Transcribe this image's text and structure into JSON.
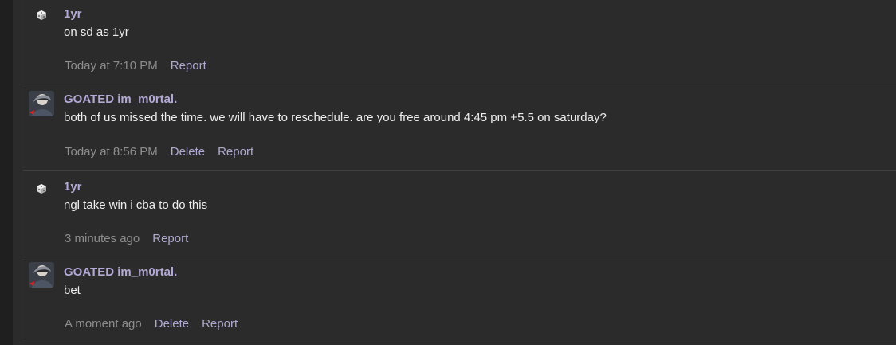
{
  "messages": [
    {
      "username": "1yr",
      "text": "on sd as 1yr",
      "time": "Today at 7:10 PM",
      "actions": [
        "Report"
      ],
      "avatar_icon": "dice-icon"
    },
    {
      "username": "GOATED im_m0rtal.",
      "text": "both of us missed the time. we will have to reschedule. are you free around 4:45 pm +5.5 on saturday?",
      "time": "Today at 8:56 PM",
      "actions": [
        "Delete",
        "Report"
      ],
      "avatar_icon": "user-avatar-image"
    },
    {
      "username": "1yr",
      "text": "ngl take win i cba to do this",
      "time": "3 minutes ago",
      "actions": [
        "Report"
      ],
      "avatar_icon": "dice-icon"
    },
    {
      "username": "GOATED im_m0rtal.",
      "text": "bet",
      "time": "A moment ago",
      "actions": [
        "Delete",
        "Report"
      ],
      "avatar_icon": "user-avatar-image"
    }
  ],
  "colors": {
    "background": "#2b2b2b",
    "username": "#b4a9d6",
    "text": "#eeeeee",
    "meta": "#8d8d8d",
    "link": "#b0a8d0"
  }
}
